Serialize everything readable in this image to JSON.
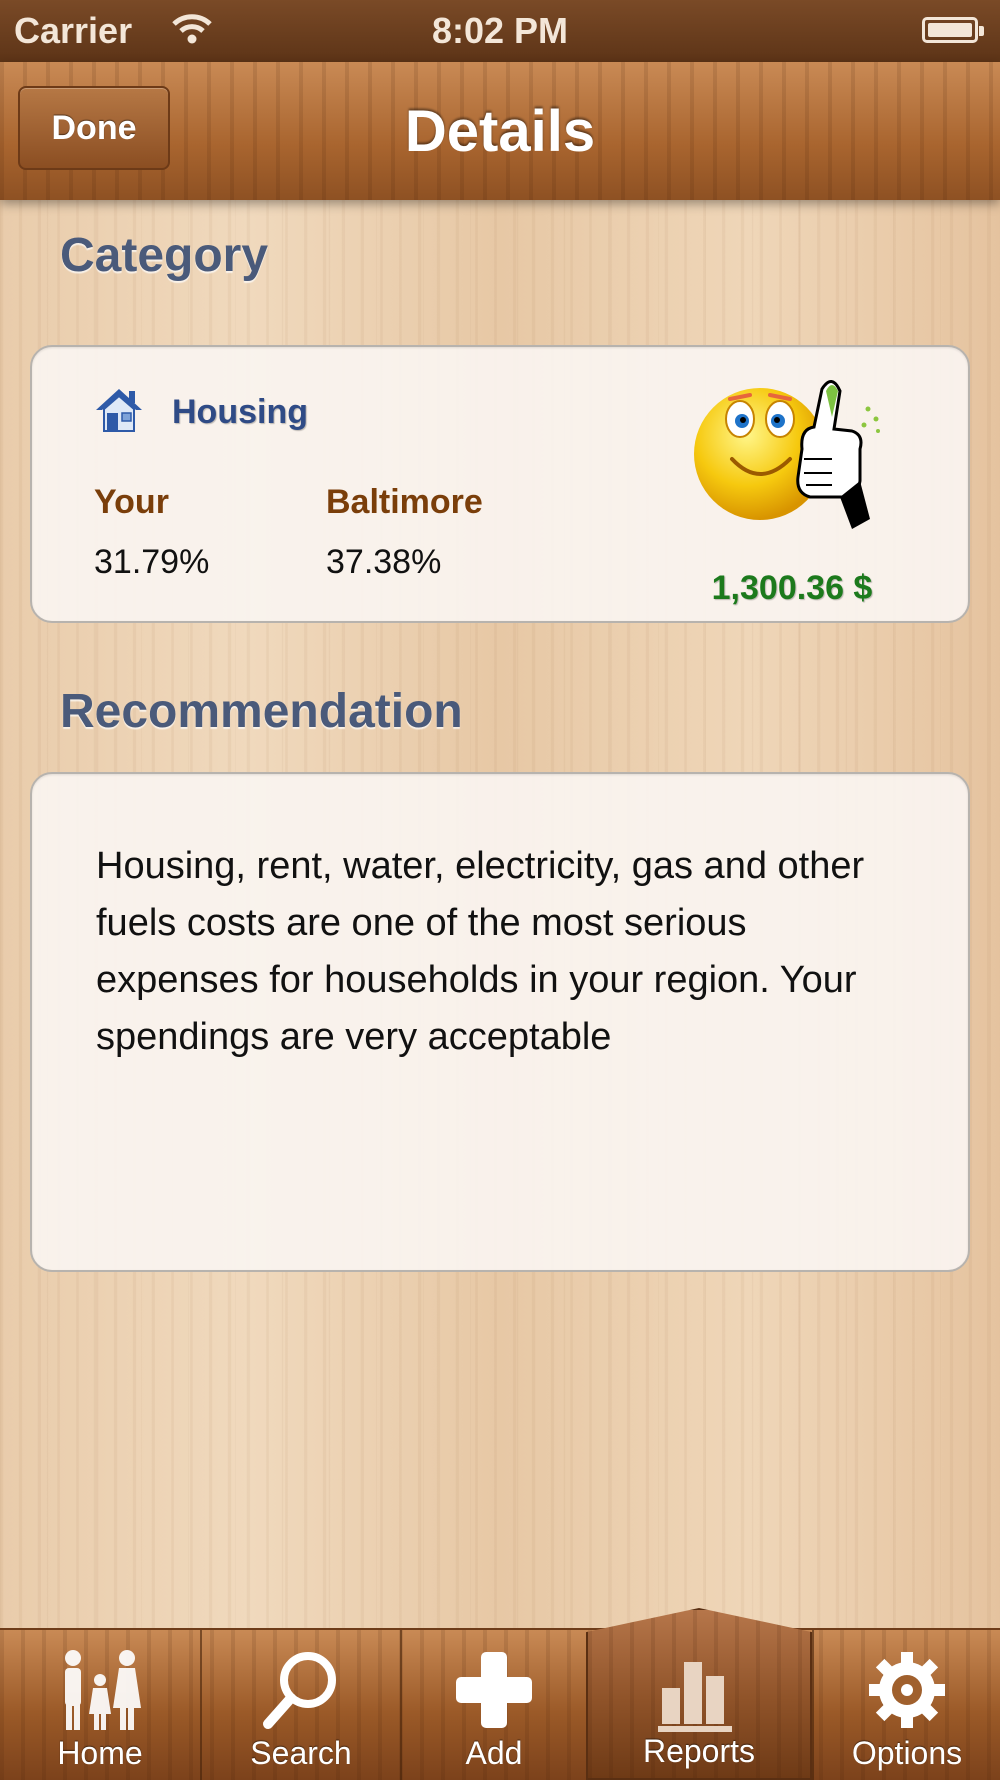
{
  "status_bar": {
    "carrier": "Carrier",
    "time": "8:02 PM"
  },
  "nav": {
    "title": "Details",
    "done_label": "Done"
  },
  "category_section": {
    "heading": "Category",
    "category": "Housing",
    "your_label": "Your",
    "your_value": "31.79%",
    "region_label": "Baltimore",
    "region_value": "37.38%",
    "amount": "1,300.36 $",
    "icons": {
      "category": "house-icon",
      "status": "smiley-thumbs-up-icon"
    }
  },
  "recommendation_section": {
    "heading": "Recommendation",
    "text": "Housing, rent, water, electricity, gas and other fuels costs are one of the most serious expenses for households in your region. Your spendings are very acceptable"
  },
  "tabbar": {
    "tabs": [
      {
        "label": "Home",
        "icon": "family-icon"
      },
      {
        "label": "Search",
        "icon": "search-icon"
      },
      {
        "label": "Add",
        "icon": "plus-icon"
      },
      {
        "label": "Reports",
        "icon": "bar-chart-icon",
        "selected": true
      },
      {
        "label": "Options",
        "icon": "gear-icon"
      }
    ]
  },
  "colors": {
    "section_heading": "#4a5a7a",
    "amount": "#1c7a1c",
    "column_label": "#7a3e0a",
    "category": "#2f4b86"
  }
}
